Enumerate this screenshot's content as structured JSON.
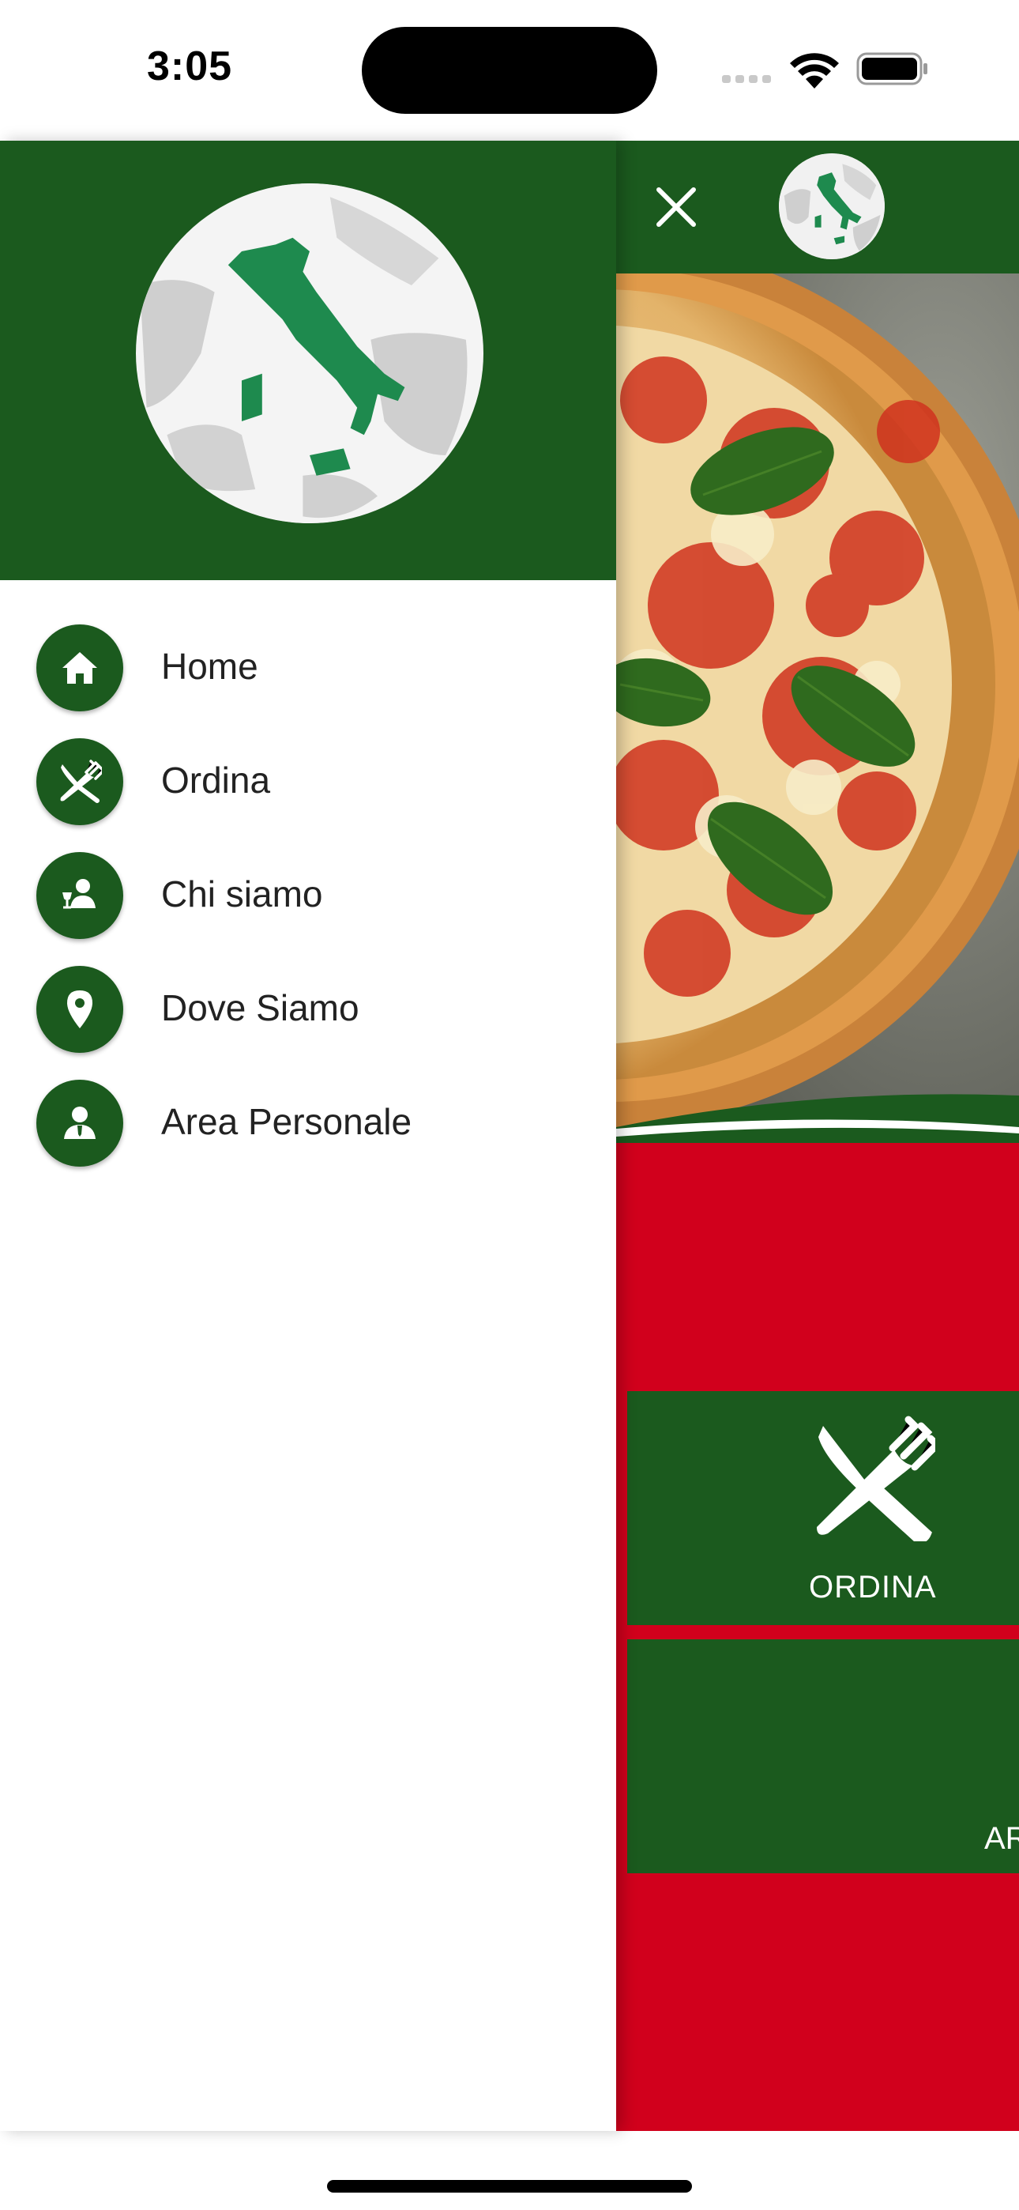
{
  "status_bar": {
    "time": "3:05",
    "signal_icon": "cellular-signal-icon",
    "wifi_icon": "wifi-icon",
    "battery_icon": "battery-icon"
  },
  "drawer": {
    "logo_icon": "italy-globe-logo",
    "menu_items": [
      {
        "label": "Home",
        "icon": "home-icon"
      },
      {
        "label": "Ordina",
        "icon": "fork-knife-icon"
      },
      {
        "label": "Chi siamo",
        "icon": "waiter-icon"
      },
      {
        "label": "Dove Siamo",
        "icon": "location-pin-icon"
      },
      {
        "label": "Area Personale",
        "icon": "user-icon"
      }
    ]
  },
  "main_screen": {
    "close_icon": "close-icon",
    "hero_image": "pizza-margherita-photo",
    "tiles": [
      {
        "label": "ORDINA",
        "icon": "fork-knife-icon"
      },
      {
        "label": "AR"
      }
    ]
  },
  "colors": {
    "brand_green": "#1b5a1e",
    "brand_red": "#d1001c",
    "map_green": "#1e8a4e"
  }
}
